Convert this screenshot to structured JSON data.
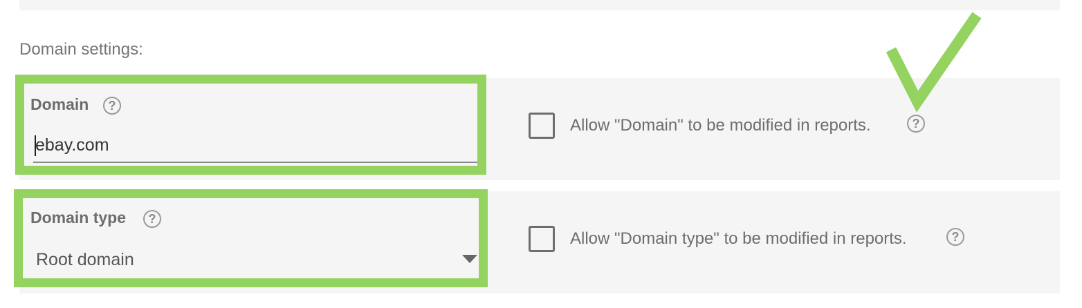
{
  "section": {
    "title": "Domain settings:"
  },
  "domain": {
    "label": "Domain",
    "value": "ebay.com",
    "help_icon": "help-circle-icon",
    "allow_label": "Allow \"Domain\" to be modified in reports.",
    "allow_checked": false
  },
  "domain_type": {
    "label": "Domain type",
    "selected": "Root domain",
    "help_icon": "help-circle-icon",
    "allow_label": "Allow \"Domain type\" to be modified in reports.",
    "allow_checked": false
  },
  "help_glyph": "?",
  "annotations": {
    "highlight_color": "#94d35f",
    "checkmark_icon": "checkmark-icon"
  }
}
